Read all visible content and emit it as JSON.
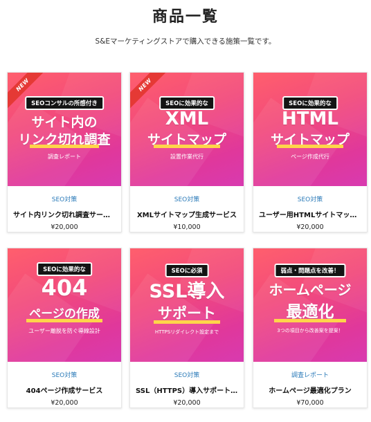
{
  "page": {
    "title": "商品一覧",
    "subtitle": "S&Eマーケティングストアで購入できる施策一覧です。"
  },
  "products": [
    {
      "badge": "NEW",
      "thumb_pill": "SEOコンサルの所感付き",
      "thumb_line1": "サイト内の",
      "thumb_line2": "リンク切れ調査",
      "thumb_small": "調査レポート",
      "category": "SEO対策",
      "name": "サイト内リンク切れ調査サービス",
      "price": "¥20,000"
    },
    {
      "badge": "NEW",
      "thumb_pill": "SEOに効果的な",
      "thumb_line1": "XML",
      "thumb_line2": "サイトマップ",
      "thumb_small": "設置作業代行",
      "category": "SEO対策",
      "name": "XMLサイトマップ生成サービス",
      "price": "¥10,000"
    },
    {
      "badge": "",
      "thumb_pill": "SEOに効果的な",
      "thumb_line1": "HTML",
      "thumb_line2": "サイトマップ",
      "thumb_small": "ページ作成代行",
      "category": "SEO対策",
      "name": "ユーザー用HTMLサイトマップ作成",
      "price": "¥20,000"
    },
    {
      "badge": "",
      "thumb_pill": "SEOに効果的な",
      "thumb_line1": "404",
      "thumb_line2": "ページの作成",
      "thumb_small": "ユーザー離脱を防ぐ導線設計",
      "category": "SEO対策",
      "name": "404ページ作成サービス",
      "price": "¥20,000"
    },
    {
      "badge": "",
      "thumb_pill": "SEOに必須",
      "thumb_line1": "SSL導入",
      "thumb_line2": "サポート",
      "thumb_small": "HTTPSリダイレクト設定まで",
      "category": "SEO対策",
      "name": "SSL（HTTPS）導入サポートサービス",
      "price": "¥20,000"
    },
    {
      "badge": "",
      "thumb_pill": "弱点・問題点を改善！",
      "thumb_line1": "ホームページ",
      "thumb_line2": "最適化",
      "thumb_small": "3つの項目から改善案を提案！",
      "category": "調査レポート",
      "name": "ホームページ最適化プラン",
      "price": "¥70,000"
    }
  ],
  "colors": {
    "category_link": "#2a7ab8",
    "thumb_gradient_start": "#ff5f6d",
    "thumb_gradient_end": "#d83ab0",
    "underline": "#ffd54a",
    "new_ribbon": "#e53935"
  }
}
